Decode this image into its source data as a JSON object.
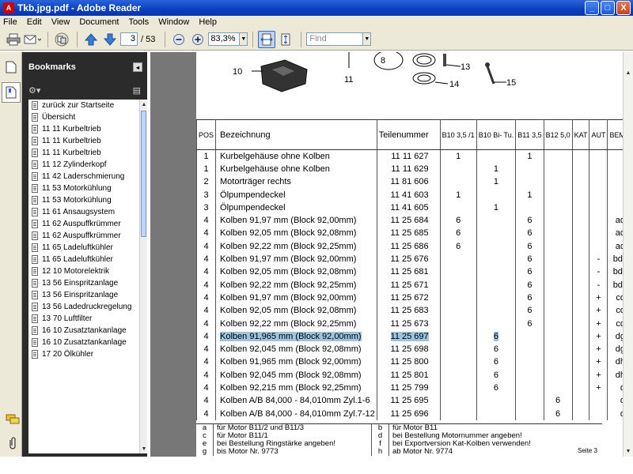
{
  "window": {
    "title": "Tkb.jpg.pdf - Adobe Reader",
    "icon_letter": "A",
    "minimize": "_",
    "maximize": "□",
    "close": "X"
  },
  "menu": [
    "File",
    "Edit",
    "View",
    "Document",
    "Tools",
    "Window",
    "Help"
  ],
  "toolbar": {
    "page_current": "3",
    "page_total": "/ 53",
    "zoom": "83,3%",
    "find_placeholder": "Find"
  },
  "bookmarks": {
    "title": "Bookmarks",
    "close": "◂",
    "items": [
      "zurück zur Startseite",
      "Übersicht",
      "11 11 Kurbeltrieb",
      "11 11 Kurbeltrieb",
      "11 11 Kurbeltrieb",
      "11 12 Zylinderkopf",
      "11 42 Laderschmierung",
      "11 53 Motorkühlung",
      "11 53 Motorkühlung",
      "11 61 Ansaugsystem",
      "11 62 Auspuffkrümmer",
      "11 62 Auspuffkrümmer",
      "11 65 Ladeluftkühler",
      "11 65 Ladeluftkühler",
      "12 10 Motorelektrik",
      "13 56 Einspritzanlage",
      "13 56 Einspritzanlage",
      "13 56 Ladedruckregelung",
      "13 70 Luftfilter",
      "16 10 Zusatztankanlage",
      "16 10 Zusatztankanlage",
      "17 20 Ölkühler"
    ]
  },
  "diagram": {
    "labels": [
      "10",
      "11",
      "8",
      "13",
      "14",
      "15"
    ]
  },
  "table": {
    "headers": {
      "pos": "POS",
      "bez": "Bezeichnung",
      "tn": "Teilenummer",
      "b1": "B10 3,5 /1",
      "b2": "B10 Bi- Tu.",
      "b3": "B11 3,5",
      "b4": "B12 5,0",
      "kat": "KAT",
      "aut": "AUT",
      "bem": "BEM"
    },
    "rows": [
      [
        "1",
        "Kurbelgehäuse ohne Kolben",
        "11 11 627",
        "1",
        "",
        "1",
        "",
        "",
        "",
        ""
      ],
      [
        "1",
        "Kurbelgehäuse ohne Kolben",
        "11 11 629",
        "",
        "1",
        "",
        "",
        "",
        "",
        ""
      ],
      [
        "2",
        "Motorträger rechts",
        "11 81 606",
        "",
        "1",
        "",
        "",
        "",
        "",
        ""
      ],
      [
        "3",
        "Ölpumpendeckel",
        "11 41 603",
        "1",
        "",
        "1",
        "",
        "",
        "",
        ""
      ],
      [
        "3",
        "Ölpumpendeckel",
        "11 41 605",
        "",
        "1",
        "",
        "",
        "",
        "",
        ""
      ],
      [
        "4",
        "Kolben 91,97 mm (Block 92,00mm)",
        "11 25 684",
        "6",
        "",
        "6",
        "",
        "",
        "",
        "ad"
      ],
      [
        "4",
        "Kolben 92,05 mm (Block 92,08mm)",
        "11 25 685",
        "6",
        "",
        "6",
        "",
        "",
        "",
        "ad"
      ],
      [
        "4",
        "Kolben 92,22 mm (Block 92,25mm)",
        "11 25 686",
        "6",
        "",
        "6",
        "",
        "",
        "",
        "ad"
      ],
      [
        "4",
        "Kolben 91,97 mm (Block 92,00mm)",
        "11 25 676",
        "",
        "",
        "6",
        "",
        "",
        "-",
        "bdf"
      ],
      [
        "4",
        "Kolben 92,05 mm (Block 92,08mm)",
        "11 25 681",
        "",
        "",
        "6",
        "",
        "",
        "-",
        "bdf"
      ],
      [
        "4",
        "Kolben 92,22 mm (Block 92,25mm)",
        "11 25 671",
        "",
        "",
        "6",
        "",
        "",
        "-",
        "bdf"
      ],
      [
        "4",
        "Kolben 91,97 mm (Block 92,00mm)",
        "11 25 672",
        "",
        "",
        "6",
        "",
        "",
        "+",
        "cd"
      ],
      [
        "4",
        "Kolben 92,05 mm (Block 92,08mm)",
        "11 25 683",
        "",
        "",
        "6",
        "",
        "",
        "+",
        "cd"
      ],
      [
        "4",
        "Kolben 92,22 mm (Block 92,25mm)",
        "11 25 673",
        "",
        "",
        "6",
        "",
        "",
        "+",
        "cd"
      ],
      [
        "4",
        "Kolben 91,965 mm (Block 92,00mm)",
        "11 25 697",
        "",
        "6",
        "",
        "",
        "",
        "+",
        "dg"
      ],
      [
        "4",
        "Kolben 92,045 mm (Block 92,08mm)",
        "11 25 698",
        "",
        "6",
        "",
        "",
        "",
        "+",
        "dg"
      ],
      [
        "4",
        "Kolben 91,965 mm (Block 92,00mm)",
        "11 25 800",
        "",
        "6",
        "",
        "",
        "",
        "+",
        "dh"
      ],
      [
        "4",
        "Kolben 92,045 mm (Block 92,08mm)",
        "11 25 801",
        "",
        "6",
        "",
        "",
        "",
        "+",
        "dh"
      ],
      [
        "4",
        "Kolben 92,215 mm (Block 92,25mm)",
        "11 25 799",
        "",
        "6",
        "",
        "",
        "",
        "+",
        "d"
      ],
      [
        "4",
        "Kolben A/B 84,000 - 84,010mm  Zyl.1-6",
        "11 25 695",
        "",
        "",
        "",
        "6",
        "",
        "",
        "d"
      ],
      [
        "4",
        "Kolben A/B 84,000 - 84,010mm  Zyl.7-12",
        "11 25 696",
        "",
        "",
        "",
        "6",
        "",
        "",
        "d"
      ]
    ],
    "selected_row": 14
  },
  "notes": [
    [
      "a",
      "für Motor B11/2 und B11/3",
      "b",
      "für Motor B11"
    ],
    [
      "c",
      "für Motor B11/1",
      "d",
      "bei Bestellung Motornummer angeben!"
    ],
    [
      "e",
      "bei Bestellung Ringstärke angeben!",
      "f",
      "bei Exportversion Kat-Kolben verwenden!"
    ],
    [
      "g",
      "bis Motor Nr. 9773",
      "h",
      "ab Motor Nr. 9774"
    ]
  ],
  "page_label": "Seite 3",
  "colors": {
    "titlebar": "#0a3fbf",
    "selection": "#9fc2df",
    "panel": "#2b2b2b"
  }
}
